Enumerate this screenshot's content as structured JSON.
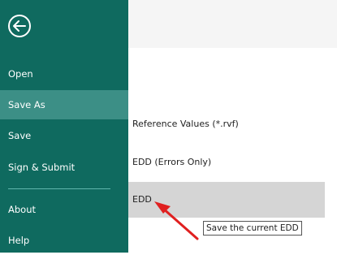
{
  "sidebar": {
    "back_icon": "left-arrow-circle-icon",
    "items": [
      {
        "label": "Open"
      },
      {
        "label": "Save As"
      },
      {
        "label": "Save"
      },
      {
        "label": "Sign & Submit"
      },
      {
        "label": "About"
      },
      {
        "label": "Help"
      }
    ],
    "active_item": "Save As"
  },
  "save_as_options": [
    {
      "label": "Reference Values (*.rvf)"
    },
    {
      "label": "EDD (Errors Only)"
    },
    {
      "label": "EDD"
    }
  ],
  "tooltip": {
    "text": "Save the current EDD"
  },
  "colors": {
    "sidebar": "#0f6a5f",
    "sidebar_active": "#3c8f86",
    "hover": "#d5d5d5",
    "annotation_arrow": "#e02020"
  }
}
